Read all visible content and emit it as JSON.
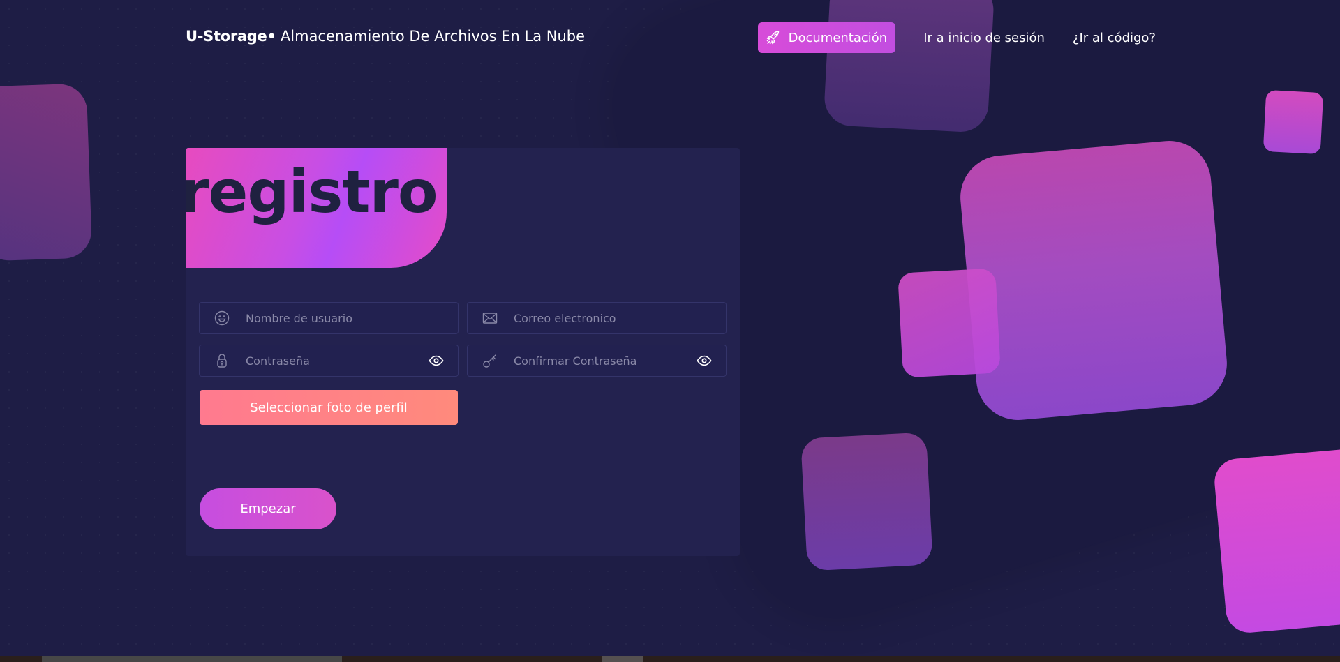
{
  "header": {
    "brand_name": "U-Storage",
    "brand_dot": "•",
    "brand_tagline": "Almacenamiento De Archivos En La Nube",
    "nav": {
      "docs_label": "Documentación",
      "login_label": "Ir a inicio de sesión",
      "code_label": "¿Ir al código?"
    }
  },
  "form": {
    "title": "registro",
    "username": {
      "value": "",
      "placeholder": "Nombre de usuario",
      "icon": "smile-icon"
    },
    "email": {
      "value": "",
      "placeholder": "Correo electronico",
      "icon": "envelope-icon"
    },
    "password": {
      "value": "",
      "placeholder": "Contraseña",
      "icon": "lock-icon"
    },
    "confirm_password": {
      "value": "",
      "placeholder": "Confirmar Contraseña",
      "icon": "key-icon"
    },
    "photo_button_label": "Seleccionar foto de perfil",
    "submit_label": "Empezar"
  },
  "colors": {
    "background": "#1e1d45",
    "card": "#23224f",
    "accent_magenta": "#d74cd9",
    "accent_coral": "#ff7f86",
    "title_text": "#1f2140"
  }
}
